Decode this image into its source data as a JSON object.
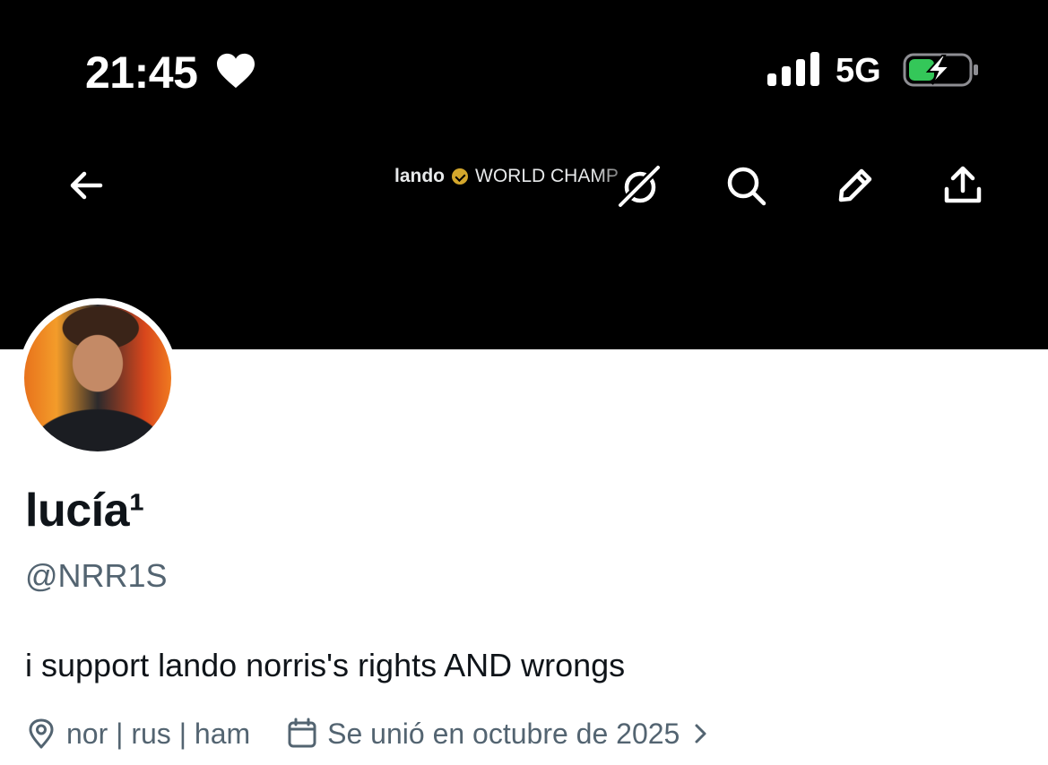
{
  "status_bar": {
    "time": "21:45",
    "network": "5G"
  },
  "banner": {
    "caption_user": "lando",
    "caption_text": "WORLD CHAMP"
  },
  "profile": {
    "display_name": "lucía¹",
    "handle": "@NRR1S",
    "bio": "i support lando norris's rights AND wrongs",
    "location": "nor | rus | ham",
    "joined": "Se unió en octubre de 2025"
  },
  "colors": {
    "banner_bg": "#000000",
    "text_primary": "#0f1419",
    "text_secondary": "#536471",
    "battery_charge": "#34c759",
    "verified_gold": "#d4a72c"
  }
}
